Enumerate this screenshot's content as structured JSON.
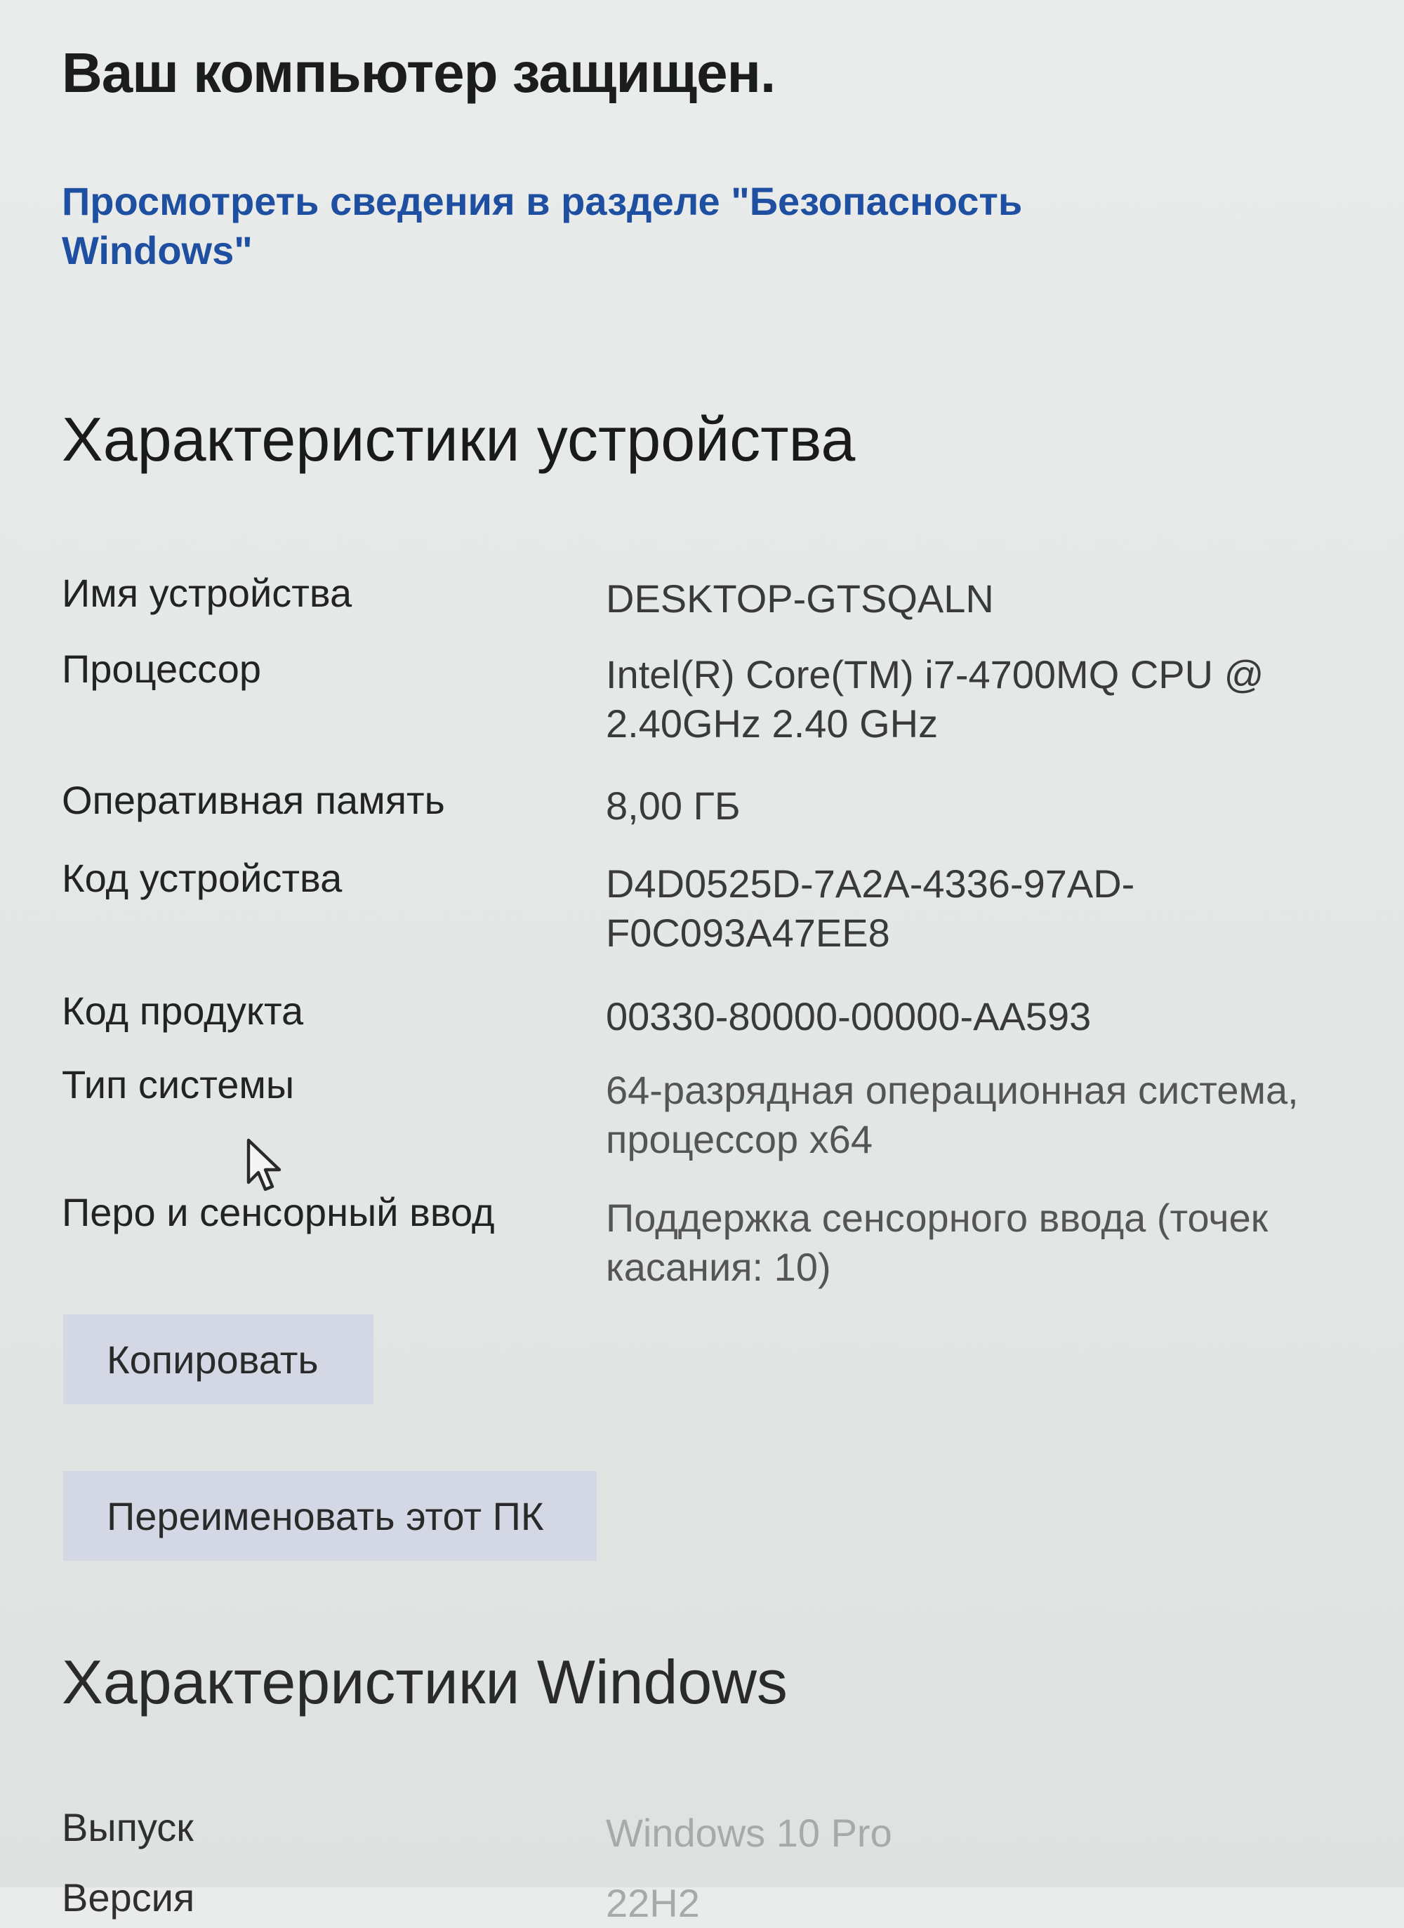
{
  "status": {
    "title": "Ваш компьютер защищен.",
    "security_link": "Просмотреть сведения в разделе \"Безопасность Windows\""
  },
  "device_specs": {
    "heading": "Характеристики устройства",
    "rows": [
      {
        "label": "Имя устройства",
        "value": "DESKTOP-GTSQALN"
      },
      {
        "label": "Процессор",
        "value": "Intel(R) Core(TM) i7-4700MQ CPU @ 2.40GHz   2.40 GHz"
      },
      {
        "label": "Оперативная память",
        "value": "8,00 ГБ"
      },
      {
        "label": "Код устройства",
        "value": "D4D0525D-7A2A-4336-97AD-F0C093A47EE8"
      },
      {
        "label": "Код продукта",
        "value": "00330-80000-00000-AA593"
      },
      {
        "label": "Тип системы",
        "value": "64-разрядная операционная система, процессор x64"
      },
      {
        "label": "Перо и сенсорный ввод",
        "value": "Поддержка сенсорного ввода (точек касания: 10)"
      }
    ],
    "copy_button": "Копировать",
    "rename_button": "Переименовать этот ПК"
  },
  "windows_specs": {
    "heading": "Характеристики Windows",
    "rows": [
      {
        "label": "Выпуск",
        "value": "Windows 10 Pro"
      },
      {
        "label": "Версия",
        "value": "22H2"
      }
    ]
  },
  "icons": {
    "cursor": "mouse-pointer-icon"
  }
}
